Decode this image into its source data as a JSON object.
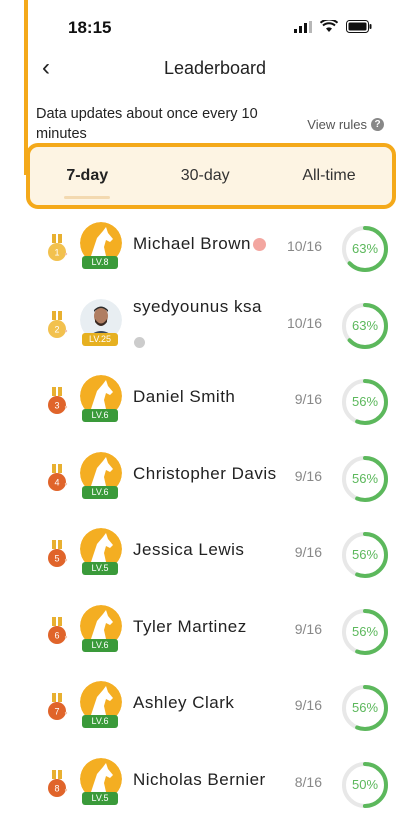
{
  "status": {
    "time": "18:15"
  },
  "header": {
    "back_icon": "‹",
    "title": "Leaderboard"
  },
  "info": {
    "text": "Data updates about once every 10 minutes",
    "rules_label": "View rules",
    "rules_icon": "?"
  },
  "tabs": [
    {
      "label": "7-day",
      "active": true
    },
    {
      "label": "30-day",
      "active": false
    },
    {
      "label": "All-time",
      "active": false
    }
  ],
  "colors": {
    "accent": "#F4A91A",
    "progress": "#5CB85C",
    "level_green": "#3A9A3A",
    "level_gold": "#E6B020"
  },
  "rows": [
    {
      "rank": "1",
      "name": "Michael Brown",
      "level": "LV.8",
      "score": "10/16",
      "percent": "63%",
      "progress": 0.63,
      "medal_color": "#F2C14E",
      "avatar": "horse-avatar",
      "level_style": "green",
      "badge": "pink-dot"
    },
    {
      "rank": "2",
      "name": "syedyounus ksa",
      "level": "LV.25",
      "score": "10/16",
      "percent": "63%",
      "progress": 0.63,
      "medal_color": "#F2C14E",
      "avatar": "photo-avatar",
      "level_style": "gold",
      "badge": "grey-dot"
    },
    {
      "rank": "3",
      "name": "Daniel Smith",
      "level": "LV.6",
      "score": "9/16",
      "percent": "56%",
      "progress": 0.56,
      "medal_color": "#E0642A",
      "avatar": "horse-avatar",
      "level_style": "green"
    },
    {
      "rank": "4",
      "name": "Christopher Davis",
      "level": "LV.6",
      "score": "9/16",
      "percent": "56%",
      "progress": 0.56,
      "medal_color": "#E0642A",
      "avatar": "horse-avatar",
      "level_style": "green"
    },
    {
      "rank": "5",
      "name": "Jessica Lewis",
      "level": "LV.5",
      "score": "9/16",
      "percent": "56%",
      "progress": 0.56,
      "medal_color": "#E0642A",
      "avatar": "horse-avatar",
      "level_style": "green"
    },
    {
      "rank": "6",
      "name": "Tyler Martinez",
      "level": "LV.6",
      "score": "9/16",
      "percent": "56%",
      "progress": 0.56,
      "medal_color": "#E0642A",
      "avatar": "horse-avatar",
      "level_style": "green"
    },
    {
      "rank": "7",
      "name": "Ashley Clark",
      "level": "LV.6",
      "score": "9/16",
      "percent": "56%",
      "progress": 0.56,
      "medal_color": "#E0642A",
      "avatar": "horse-avatar",
      "level_style": "green"
    },
    {
      "rank": "8",
      "name": "Nicholas Bernier",
      "level": "LV.5",
      "score": "8/16",
      "percent": "50%",
      "progress": 0.5,
      "medal_color": "#E0642A",
      "avatar": "horse-avatar",
      "level_style": "green"
    }
  ]
}
